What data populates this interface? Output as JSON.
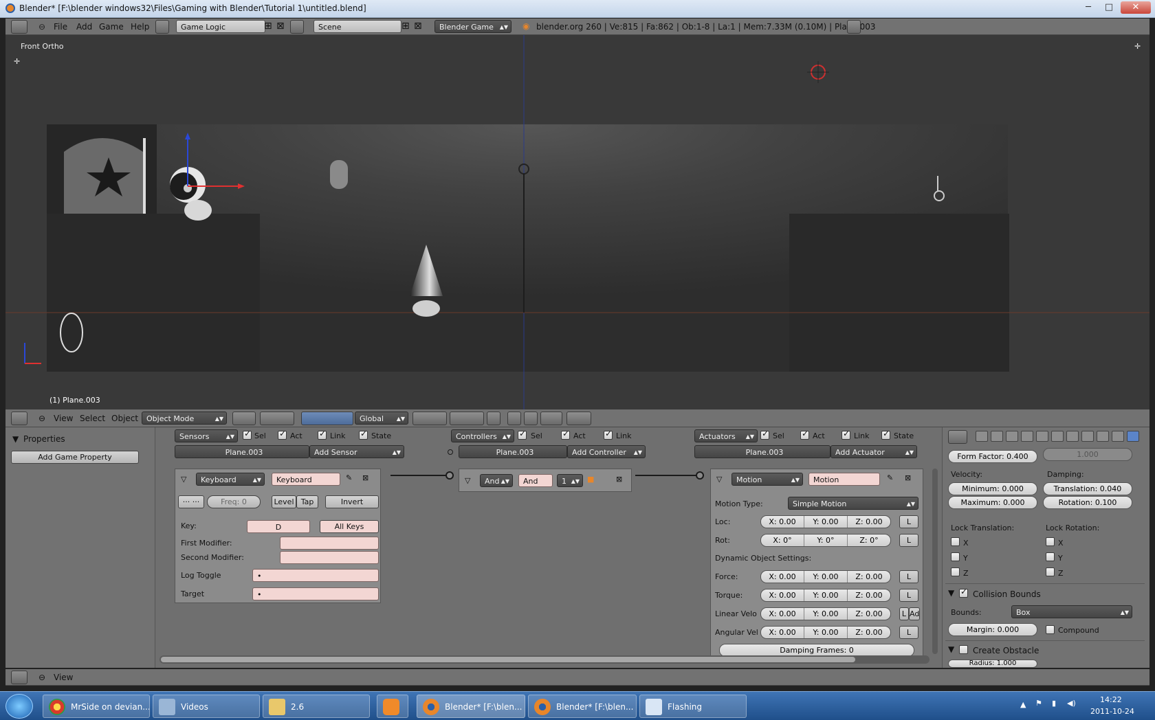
{
  "window": {
    "title": "Blender* [F:\\blender windows32\\Files\\Gaming with Blender\\Tutorial 1\\untitled.blend]",
    "min": "─",
    "max": "□",
    "close": "✕"
  },
  "topbar": {
    "menus": [
      "File",
      "Add",
      "Game",
      "Help"
    ],
    "layout": "Game Logic",
    "scene": "Scene",
    "engine": "Blender Game",
    "stats": "blender.org 260 | Ve:815 | Fa:862 | Ob:1-8 | La:1 | Mem:7.33M (0.10M) | Plane.003"
  },
  "viewport": {
    "view_name": "Front Ortho",
    "object_label": "(1) Plane.003"
  },
  "v3d_header": {
    "menus": [
      "View",
      "Select",
      "Object"
    ],
    "mode": "Object Mode",
    "orientation": "Global"
  },
  "logic": {
    "properties_title": "Properties",
    "add_prop": "Add Game Property",
    "sensors": {
      "title": "Sensors",
      "sel": "Sel",
      "act": "Act",
      "link": "Link",
      "state": "State",
      "object": "Plane.003",
      "add": "Add Sensor",
      "brick": {
        "type": "Keyboard",
        "name": "Keyboard",
        "freq": "Freq: 0",
        "level": "Level",
        "tap": "Tap",
        "invert": "Invert",
        "key_label": "Key:",
        "key": "D",
        "all_keys": "All Keys",
        "first_mod": "First Modifier:",
        "second_mod": "Second Modifier:",
        "log_toggle": "Log Toggle",
        "target": "Target",
        "dot": "•"
      }
    },
    "controllers": {
      "title": "Controllers",
      "sel": "Sel",
      "act": "Act",
      "link": "Link",
      "object": "Plane.003",
      "add": "Add Controller",
      "brick": {
        "type": "And",
        "name": "And",
        "state": "1"
      }
    },
    "actuators": {
      "title": "Actuators",
      "sel": "Sel",
      "act": "Act",
      "link": "Link",
      "state": "State",
      "object": "Plane.003",
      "add": "Add Actuator",
      "brick": {
        "type": "Motion",
        "name": "Motion",
        "motion_type_label": "Motion Type:",
        "motion_type": "Simple Motion",
        "loc_label": "Loc:",
        "loc": [
          "X: 0.00",
          "Y: 0.00",
          "Z: 0.00"
        ],
        "rot_label": "Rot:",
        "rot": [
          "X: 0°",
          "Y: 0°",
          "Z: 0°"
        ],
        "dyn_label": "Dynamic Object Settings:",
        "force_label": "Force:",
        "force": [
          "X: 0.00",
          "Y: 0.00",
          "Z: 0.00"
        ],
        "torque_label": "Torque:",
        "torque": [
          "X: 0.00",
          "Y: 0.00",
          "Z: 0.00"
        ],
        "linvel_label": "Linear Velo",
        "linvel": [
          "X: 0.00",
          "Y: 0.00",
          "Z: 0.00"
        ],
        "angvel_label": "Angular Vel",
        "angvel": [
          "X: 0.00",
          "Y: 0.00",
          "Z: 0.00"
        ],
        "local": "L",
        "add": "Ad",
        "damping": "Damping Frames: 0"
      }
    }
  },
  "physics": {
    "form_factor": "Form Factor: 0.400",
    "form_right": "1.000",
    "velocity": "Velocity:",
    "damping": "Damping:",
    "vmin": "Minimum: 0.000",
    "vmax": "Maximum: 0.000",
    "dtrans": "Translation: 0.040",
    "drot": "Rotation: 0.100",
    "lock_trans": "Lock Translation:",
    "lock_rot": "Lock Rotation:",
    "x": "X",
    "y": "Y",
    "z": "Z",
    "collision": "Collision Bounds",
    "bounds_label": "Bounds:",
    "bounds": "Box",
    "margin": "Margin: 0.000",
    "compound": "Compound",
    "create_obstacle": "Create Obstacle",
    "radius": "Radius: 1.000"
  },
  "bottom": {
    "view": "View"
  },
  "taskbar": {
    "items": [
      "MrSide on devian...",
      "Videos",
      "2.6",
      "",
      "Blender* [F:\\blen...",
      "Blender* [F:\\blen...",
      "Flashing"
    ],
    "time": "14:22",
    "date": "2011-10-24"
  }
}
